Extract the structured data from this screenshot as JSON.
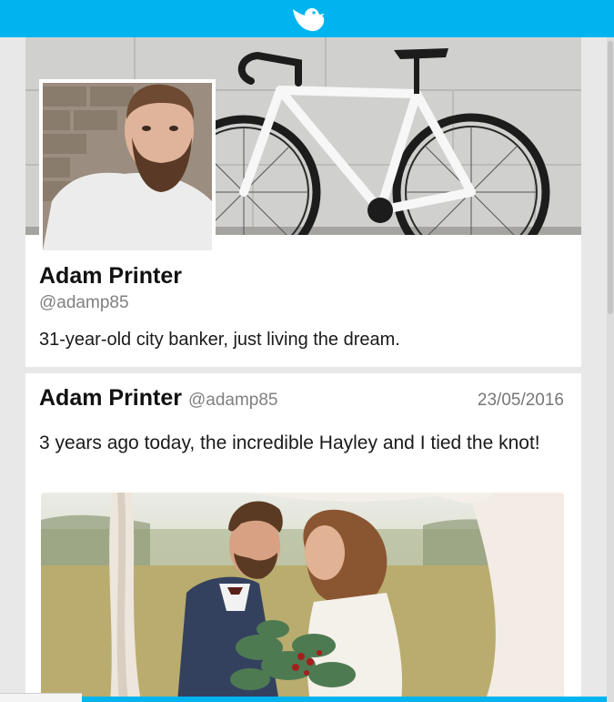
{
  "app": {
    "logo_icon": "bird-icon",
    "brand_color": "#00b4ef"
  },
  "profile": {
    "name": "Adam Printer",
    "handle": "@adamp85",
    "bio": "31-year-old city banker, just living the dream.",
    "cover_icon": "bicycle-photo",
    "avatar_icon": "avatar-photo"
  },
  "posts": [
    {
      "name": "Adam Printer",
      "handle": "@adamp85",
      "date": "23/05/2016",
      "text": "3 years ago today, the incredible Hayley and I tied the knot!",
      "photo_icon": "wedding-photo"
    }
  ]
}
